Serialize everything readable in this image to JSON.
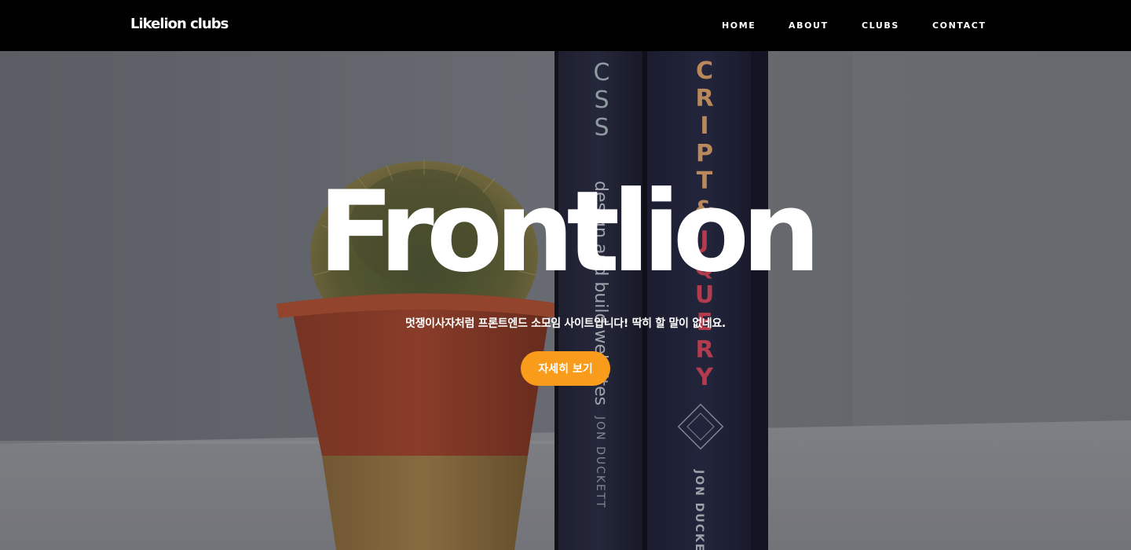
{
  "brand": {
    "logo_text": "Likelion clubs"
  },
  "nav": {
    "items": [
      {
        "label": "HOME"
      },
      {
        "label": "ABOUT"
      },
      {
        "label": "CLUBS"
      },
      {
        "label": "CONTACT"
      }
    ]
  },
  "hero": {
    "title": "Frontlion",
    "subtitle": "멋쟁이사자처럼 프론트엔드 소모임 사이트입니다! 딱히 할 말이 없네요.",
    "cta_label": "자세히 보기",
    "background": {
      "book_left_spine_text": [
        "C",
        "S",
        "S"
      ],
      "book_left_subtitle": "design and build websites",
      "book_left_author": "JON DUCKETT",
      "book_right_spine_text": [
        "C",
        "R",
        "I",
        "P",
        "T",
        "&",
        "J",
        "Q",
        "U",
        "E",
        "R",
        "Y"
      ],
      "book_right_author": "JON DUCKETT"
    }
  },
  "colors": {
    "nav_bg": "#000000",
    "accent": "#f99b1b",
    "text": "#ffffff"
  }
}
